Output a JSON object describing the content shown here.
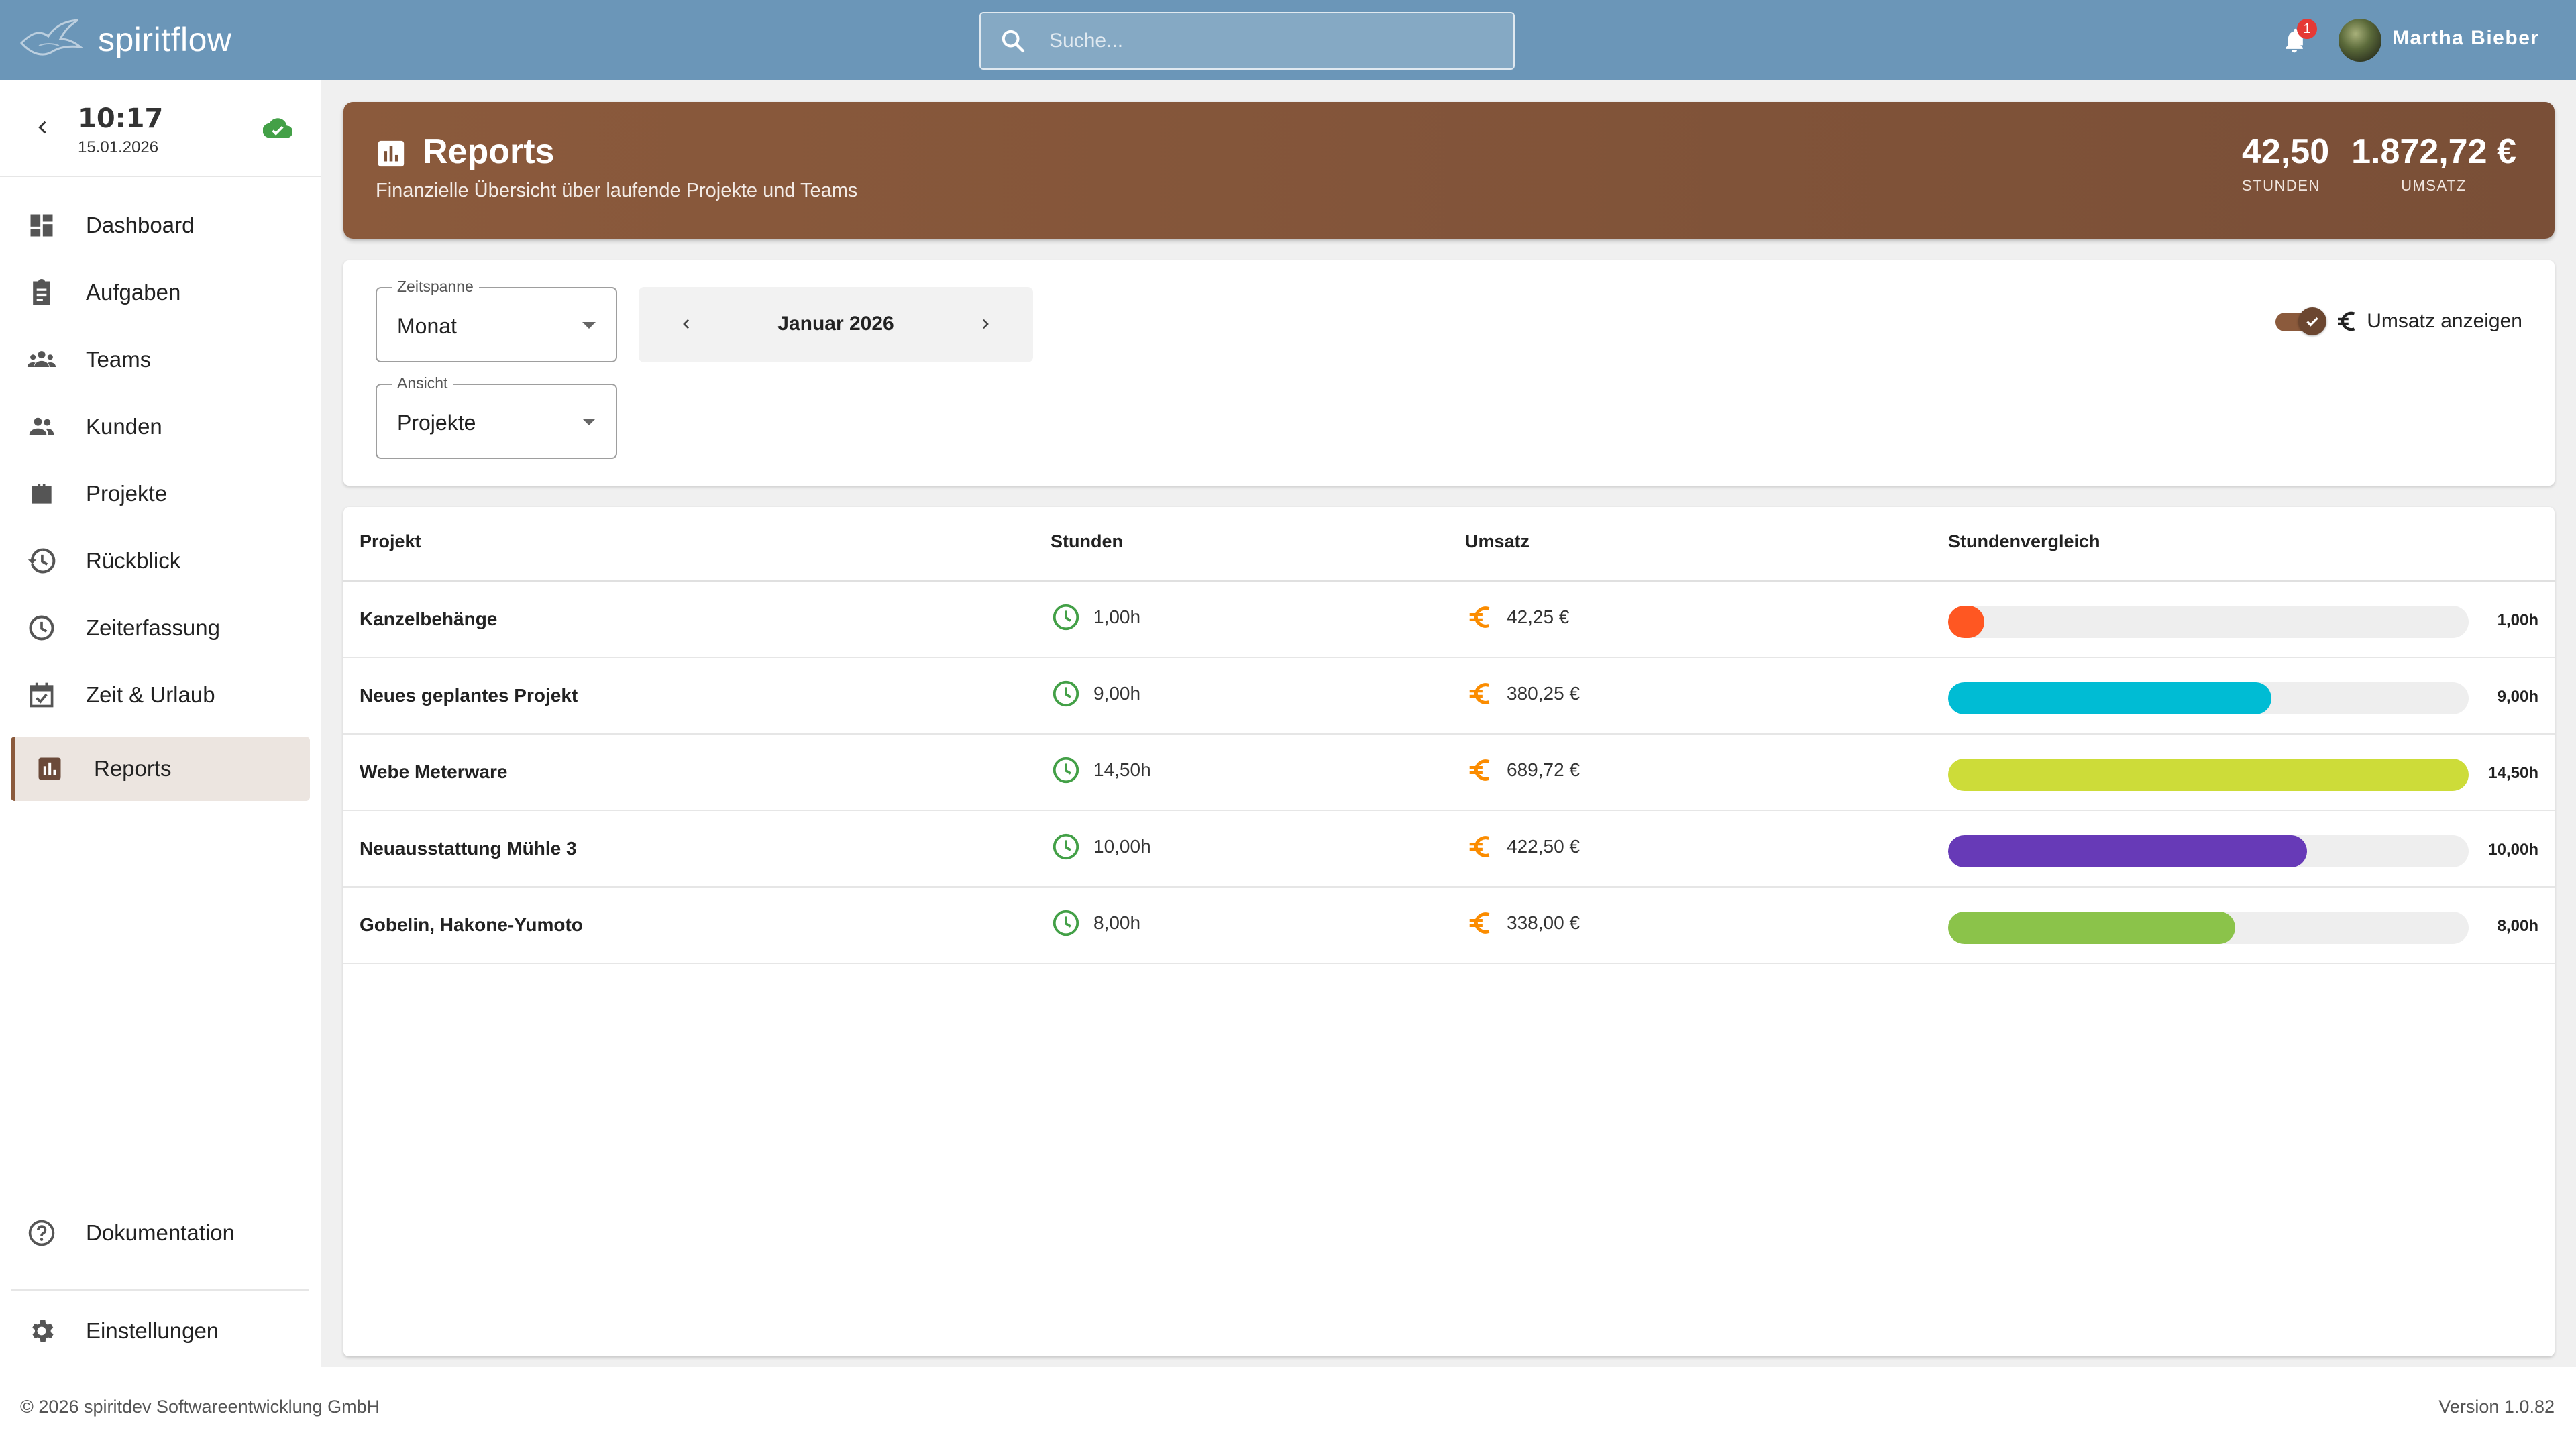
{
  "app": {
    "name": "spiritflow"
  },
  "search": {
    "placeholder": "Suche..."
  },
  "notifications": {
    "count": "1"
  },
  "user": {
    "name": "Martha Bieber"
  },
  "clock": {
    "time": "10:17",
    "date": "15.01.2026",
    "sync_status_icon": "cloud-done-icon",
    "sync_color": "#43a047"
  },
  "sidebar": {
    "items": [
      {
        "label": "Dashboard",
        "icon": "dashboard-icon"
      },
      {
        "label": "Aufgaben",
        "icon": "clipboard-icon"
      },
      {
        "label": "Teams",
        "icon": "groups-icon"
      },
      {
        "label": "Kunden",
        "icon": "people-icon"
      },
      {
        "label": "Projekte",
        "icon": "briefcase-icon"
      },
      {
        "label": "Rückblick",
        "icon": "history-icon"
      },
      {
        "label": "Zeiterfassung",
        "icon": "clock-icon"
      },
      {
        "label": "Zeit & Urlaub",
        "icon": "calendar-check-icon"
      },
      {
        "label": "Reports",
        "icon": "bar-chart-icon",
        "active": true
      }
    ],
    "documentation": "Dokumentation",
    "settings": "Einstellungen"
  },
  "header": {
    "title": "Reports",
    "subtitle": "Finanzielle Übersicht über laufende Projekte und Teams",
    "stats": [
      {
        "value": "42,50",
        "label": "STUNDEN"
      },
      {
        "value": "1.872,72 €",
        "label": "UMSATZ"
      }
    ]
  },
  "filters": {
    "zeitspanne": {
      "label": "Zeitspanne",
      "value": "Monat"
    },
    "ansicht": {
      "label": "Ansicht",
      "value": "Projekte"
    },
    "period": "Januar 2026",
    "toggle": {
      "label": "Umsatz anzeigen",
      "checked": true
    }
  },
  "table": {
    "headers": {
      "project": "Projekt",
      "hours": "Stunden",
      "revenue": "Umsatz",
      "comparison": "Stundenvergleich"
    },
    "rows": [
      {
        "project": "Kanzelbehänge",
        "hours": "1,00h",
        "revenue": "42,25 €",
        "bar_label": "1,00h",
        "hours_value": 1.0,
        "color": "#ff5722"
      },
      {
        "project": "Neues geplantes Projekt",
        "hours": "9,00h",
        "revenue": "380,25 €",
        "bar_label": "9,00h",
        "hours_value": 9.0,
        "color": "#00bcd4"
      },
      {
        "project": "Webe Meterware",
        "hours": "14,50h",
        "revenue": "689,72 €",
        "bar_label": "14,50h",
        "hours_value": 14.5,
        "color": "#cddc39"
      },
      {
        "project": "Neuausstattung Mühle 3",
        "hours": "10,00h",
        "revenue": "422,50 €",
        "bar_label": "10,00h",
        "hours_value": 10.0,
        "color": "#673ab7"
      },
      {
        "project": "Gobelin, Hakone-Yumoto",
        "hours": "8,00h",
        "revenue": "338,00 €",
        "bar_label": "8,00h",
        "hours_value": 8.0,
        "color": "#8bc34a"
      }
    ],
    "max_hours": 14.5,
    "hours_icon_color": "#43a047",
    "revenue_icon_color": "#fb8c00"
  },
  "footer": {
    "copyright": "© 2026 spiritdev Softwareentwicklung GmbH",
    "version": "Version 1.0.82"
  }
}
